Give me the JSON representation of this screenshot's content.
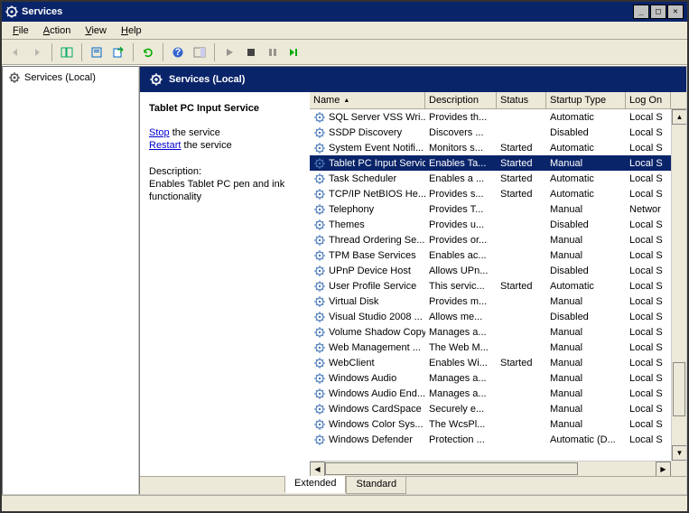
{
  "window": {
    "title": "Services"
  },
  "menu": {
    "file": "File",
    "action": "Action",
    "view": "View",
    "help": "Help"
  },
  "tree": {
    "root": "Services (Local)"
  },
  "content_header": "Services (Local)",
  "detail": {
    "title": "Tablet PC Input Service",
    "stop_label": "Stop",
    "stop_suffix": " the service",
    "restart_label": "Restart",
    "restart_suffix": " the service",
    "desc_header": "Description:",
    "desc_text": "Enables Tablet PC pen and ink functionality"
  },
  "columns": {
    "name": "Name",
    "description": "Description",
    "status": "Status",
    "startup": "Startup Type",
    "logon": "Log On"
  },
  "tabs": {
    "extended": "Extended",
    "standard": "Standard"
  },
  "services": [
    {
      "name": "SQL Server VSS Wri...",
      "desc": "Provides th...",
      "status": "",
      "start": "Automatic",
      "logon": "Local S"
    },
    {
      "name": "SSDP Discovery",
      "desc": "Discovers ...",
      "status": "",
      "start": "Disabled",
      "logon": "Local S"
    },
    {
      "name": "System Event Notifi...",
      "desc": "Monitors s...",
      "status": "Started",
      "start": "Automatic",
      "logon": "Local S"
    },
    {
      "name": "Tablet PC Input Service",
      "desc": "Enables Ta...",
      "status": "Started",
      "start": "Manual",
      "logon": "Local S",
      "selected": true
    },
    {
      "name": "Task Scheduler",
      "desc": "Enables a ...",
      "status": "Started",
      "start": "Automatic",
      "logon": "Local S"
    },
    {
      "name": "TCP/IP NetBIOS He...",
      "desc": "Provides s...",
      "status": "Started",
      "start": "Automatic",
      "logon": "Local S"
    },
    {
      "name": "Telephony",
      "desc": "Provides T...",
      "status": "",
      "start": "Manual",
      "logon": "Networ"
    },
    {
      "name": "Themes",
      "desc": "Provides u...",
      "status": "",
      "start": "Disabled",
      "logon": "Local S"
    },
    {
      "name": "Thread Ordering Se...",
      "desc": "Provides or...",
      "status": "",
      "start": "Manual",
      "logon": "Local S"
    },
    {
      "name": "TPM Base Services",
      "desc": "Enables ac...",
      "status": "",
      "start": "Manual",
      "logon": "Local S"
    },
    {
      "name": "UPnP Device Host",
      "desc": "Allows UPn...",
      "status": "",
      "start": "Disabled",
      "logon": "Local S"
    },
    {
      "name": "User Profile Service",
      "desc": "This servic...",
      "status": "Started",
      "start": "Automatic",
      "logon": "Local S"
    },
    {
      "name": "Virtual Disk",
      "desc": "Provides m...",
      "status": "",
      "start": "Manual",
      "logon": "Local S"
    },
    {
      "name": "Visual Studio 2008 ...",
      "desc": "Allows me...",
      "status": "",
      "start": "Disabled",
      "logon": "Local S"
    },
    {
      "name": "Volume Shadow Copy",
      "desc": "Manages a...",
      "status": "",
      "start": "Manual",
      "logon": "Local S"
    },
    {
      "name": "Web Management ...",
      "desc": "The Web M...",
      "status": "",
      "start": "Manual",
      "logon": "Local S"
    },
    {
      "name": "WebClient",
      "desc": "Enables Wi...",
      "status": "Started",
      "start": "Manual",
      "logon": "Local S"
    },
    {
      "name": "Windows Audio",
      "desc": "Manages a...",
      "status": "",
      "start": "Manual",
      "logon": "Local S"
    },
    {
      "name": "Windows Audio End...",
      "desc": "Manages a...",
      "status": "",
      "start": "Manual",
      "logon": "Local S"
    },
    {
      "name": "Windows CardSpace",
      "desc": "Securely e...",
      "status": "",
      "start": "Manual",
      "logon": "Local S"
    },
    {
      "name": "Windows Color Sys...",
      "desc": "The WcsPl...",
      "status": "",
      "start": "Manual",
      "logon": "Local S"
    },
    {
      "name": "Windows Defender",
      "desc": "Protection ...",
      "status": "",
      "start": "Automatic (D...",
      "logon": "Local S"
    }
  ]
}
